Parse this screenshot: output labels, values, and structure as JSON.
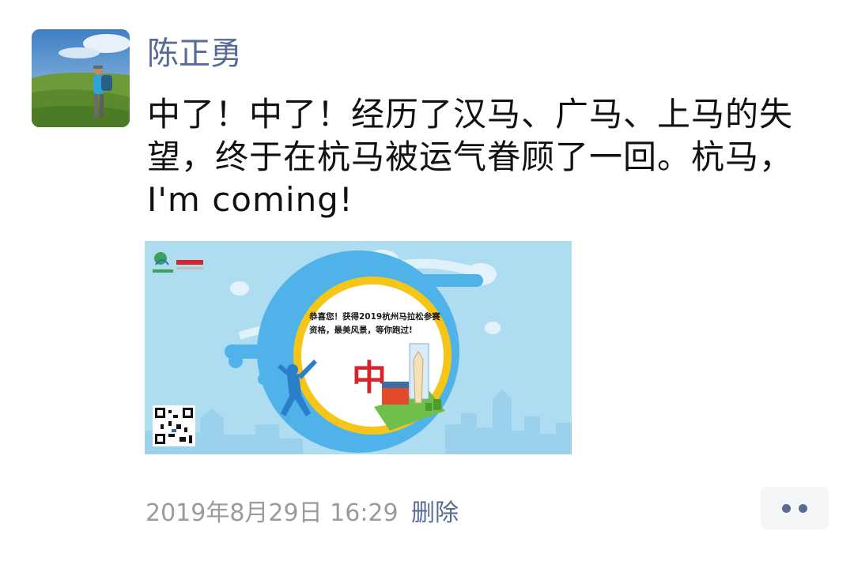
{
  "post": {
    "author": "陈正勇",
    "text": "中了！中了！经历了汉马、广马、上马的失望，终于在杭马被运气眷顾了一回。杭马，I'm coming!",
    "image": {
      "congrats_text": "恭喜您！获得2019杭州马拉松参赛资格，最美风景，等你跑过!",
      "big_char": "中",
      "colors": {
        "sky": "#a9dcf2",
        "circle": "#4fb3ea",
        "ring": "#f5c518",
        "char": "#d8232a"
      }
    },
    "timestamp": "2019年8月29日 16:29",
    "delete_label": "删除"
  }
}
